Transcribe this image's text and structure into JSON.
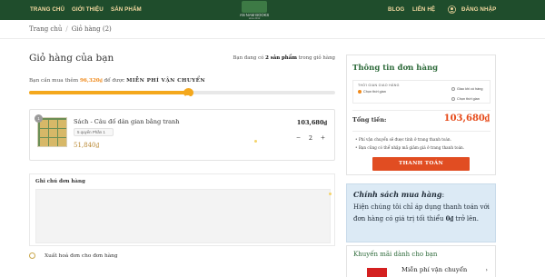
{
  "header": {
    "nav_left": [
      "TRANG CHỦ",
      "GIỚI THIỆU",
      "SẢN PHẨM"
    ],
    "logo_text": "AN NAM BOOKS",
    "logo_sub": "since 2012",
    "nav_right": [
      "BLOG",
      "LIÊN HỆ"
    ],
    "login": "ĐĂNG NHẬP",
    "bg_color": "#1f4d2c",
    "text_color": "#f3d9a0"
  },
  "breadcrumb": {
    "home": "Trang chủ",
    "sep": "/",
    "current": "Giỏ hàng (2)"
  },
  "cart": {
    "title": "Giỏ hàng của bạn",
    "count_prefix": "Bạn đang có",
    "count_bold": "2 sản phẩm",
    "count_suffix": "trong giỏ hàng",
    "ship_prefix": "Bạn cần mua thêm",
    "ship_amount": "96,320₫",
    "ship_middle": "để được",
    "ship_free": "MIỄN PHÍ VẬN CHUYỂN",
    "ship_progress": 0.52,
    "item": {
      "badge": "1",
      "name": "Sách - Câu đố dân gian bằng tranh",
      "variant": "5 quyển Phần 1",
      "orig_price": "51,840₫",
      "price": "103,680₫",
      "qty": "2",
      "minus": "−",
      "plus": "+"
    },
    "note_label": "Ghi chú đơn hàng",
    "invoice_label": "Xuất hoá đơn cho đơn hàng"
  },
  "order": {
    "title": "Thông tin đơn hàng",
    "time_label": "THỜI GIAN GIAO HÀNG",
    "options": [
      "Giao khi có hàng",
      "Chọn thời gian",
      "Chọn thời gian"
    ],
    "total_label": "Tổng tiền:",
    "total_value": "103,680₫",
    "notes": [
      "Phí vận chuyển sẽ được tính ở trang thanh toán.",
      "Bạn cũng có thể nhập mã giảm giá ở trang thanh toán."
    ],
    "checkout": "THANH TOÁN"
  },
  "policy": {
    "title": "Chính sách mua hàng",
    "title_suffix": ":",
    "text_1": "Hiện chúng tôi chỉ áp dụng thanh toán với đơn hàng có giá trị tối thiểu",
    "text_bold": "0₫",
    "text_2": "trở lên."
  },
  "promo": {
    "title": "Khuyến mãi dành cho bạn",
    "item_label": "Miễn phí vận chuyển",
    "arrow": "›"
  },
  "colors": {
    "accent_green": "#2d6a3a",
    "accent_orange": "#f08a1c",
    "checkout_red": "#e14d22",
    "policy_bg": "#dceaf5"
  }
}
